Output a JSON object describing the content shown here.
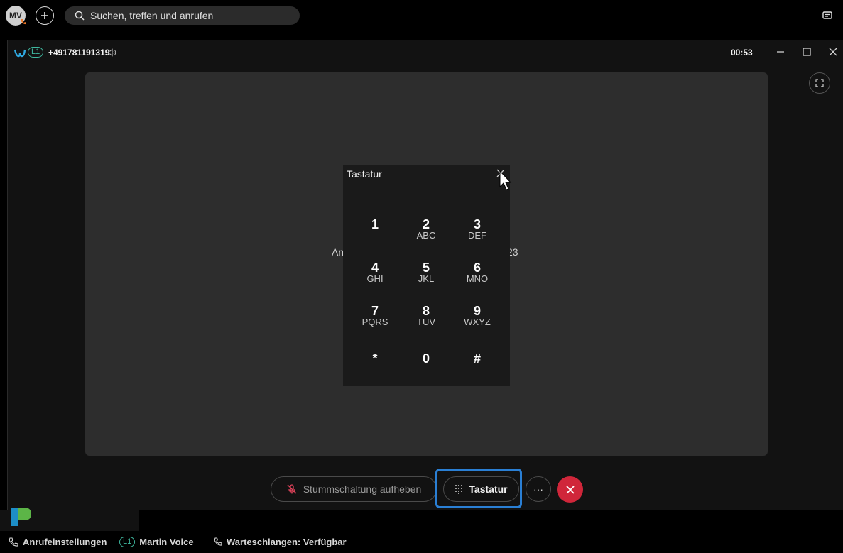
{
  "topbar": {
    "avatar_initials": "MV",
    "search_placeholder": "Suchen, treffen und anrufen"
  },
  "call": {
    "line_label": "L1",
    "number": "+491781191319",
    "timer": "00:53",
    "background_text_left": "An",
    "background_text_right": "23"
  },
  "keypad": {
    "title": "Tastatur",
    "keys": [
      {
        "num": "1",
        "letters": ""
      },
      {
        "num": "2",
        "letters": "ABC"
      },
      {
        "num": "3",
        "letters": "DEF"
      },
      {
        "num": "4",
        "letters": "GHI"
      },
      {
        "num": "5",
        "letters": "JKL"
      },
      {
        "num": "6",
        "letters": "MNO"
      },
      {
        "num": "7",
        "letters": "PQRS"
      },
      {
        "num": "8",
        "letters": "TUV"
      },
      {
        "num": "9",
        "letters": "WXYZ"
      },
      {
        "num": "*",
        "letters": ""
      },
      {
        "num": "0",
        "letters": ""
      },
      {
        "num": "#",
        "letters": ""
      }
    ]
  },
  "controls": {
    "unmute_label": "Stummschaltung aufheben",
    "keypad_label": "Tastatur",
    "more_label": "···"
  },
  "statusbar": {
    "call_settings": "Anrufeinstellungen",
    "line_label": "L1",
    "line_name": "Martin Voice",
    "queues": "Warteschlangen: Verfügbar"
  },
  "colors": {
    "accent_teal": "#3fb9a0",
    "end_call_red": "#d0263a",
    "focus_blue": "#2a7fd4",
    "mute_icon_red": "#e0425a"
  }
}
